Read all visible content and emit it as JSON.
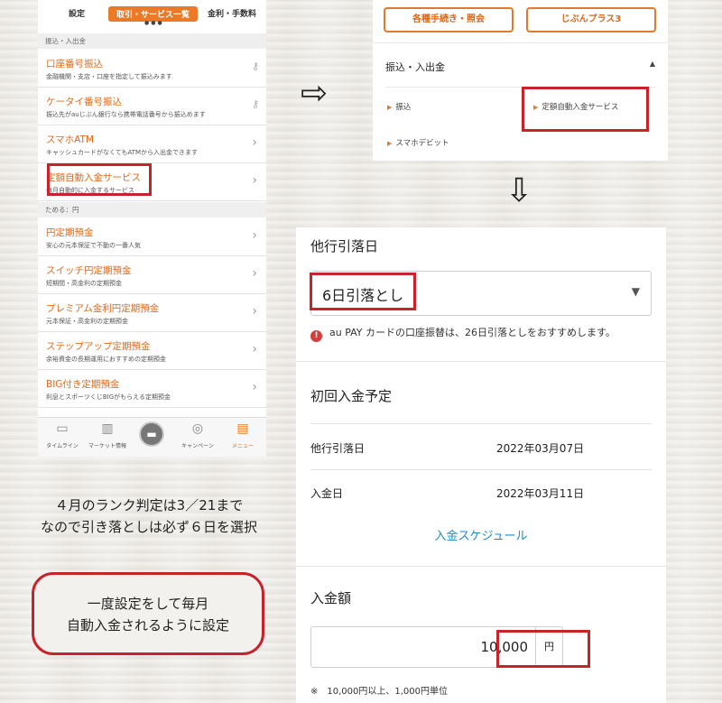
{
  "phone": {
    "tabs": [
      "設定",
      "取引・サービス一覧",
      "金利・手数料"
    ],
    "section1": "振込・入出金",
    "items1": [
      {
        "title": "口座番号振込",
        "sub": "金融機関・支店・口座を指定して振込みます",
        "icon": "key-icon"
      },
      {
        "title": "ケータイ番号振込",
        "sub": "振込先がauじぶん銀行なら携帯電話番号から振込めます",
        "icon": "key-icon"
      },
      {
        "title": "スマホATM",
        "sub": "キャッシュカードがなくてもATMから入出金できます",
        "icon": "chevron-right-icon"
      },
      {
        "title": "定額自動入金サービス",
        "sub": "毎月自動的に入金するサービス",
        "icon": "chevron-right-icon"
      }
    ],
    "section2": "ためる：円",
    "items2": [
      {
        "title": "円定期預金",
        "sub": "安心の元本保証で不動の一番人気"
      },
      {
        "title": "スイッチ円定期預金",
        "sub": "短期間・高金利の定期預金"
      },
      {
        "title": "プレミアム金利円定期預金",
        "sub": "元本保証・高金利の定期預金"
      },
      {
        "title": "ステップアップ定期預金",
        "sub": "余裕資金の長期運用におすすめの定期預金"
      },
      {
        "title": "BIG付き定期預金",
        "sub": "利息とスポーツくじBIGがもらえる定期預金"
      }
    ],
    "nav": [
      "タイムライン",
      "マーケット情報",
      "",
      "キャンペーン",
      "メニュー"
    ]
  },
  "topright": {
    "buttons": [
      "各種手続き・照会",
      "じぶんプラス3"
    ],
    "heading": "振込・入出金",
    "links": [
      "振込",
      "定額自動入金サービス",
      "スマホデビット"
    ]
  },
  "main": {
    "section_title": "他行引落日",
    "selected": "6日引落とし",
    "notice": "au PAY カードの口座振替は、26日引落としをおすすめします。",
    "plan_title": "初回入金予定",
    "rows": [
      {
        "label": "他行引落日",
        "value": "2022年03月07日"
      },
      {
        "label": "入金日",
        "value": "2022年03月11日"
      }
    ],
    "schedule_link": "入金スケジュール",
    "amount_title": "入金額",
    "amount_value": "10,000",
    "amount_unit": "円",
    "footnote": "※　10,000円以上、1,000円単位"
  },
  "annotation": {
    "line1": "４月のランク判定は3／21まで",
    "line2": "なので引き落としは必ず６日を選択",
    "bubble1": "一度設定をして毎月",
    "bubble2": "自動入金されるように設定"
  },
  "colors": {
    "accent": "#ea7a28",
    "highlight": "#c7232b",
    "link": "#1d8bc4"
  }
}
